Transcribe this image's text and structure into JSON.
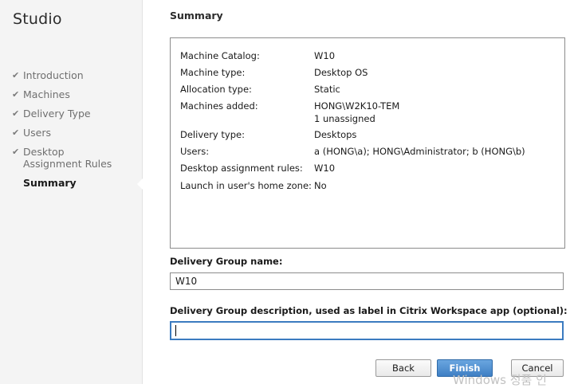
{
  "app": {
    "title": "Studio"
  },
  "sidebar": {
    "steps": [
      {
        "label": "Introduction",
        "completed": true
      },
      {
        "label": "Machines",
        "completed": true
      },
      {
        "label": "Delivery Type",
        "completed": true
      },
      {
        "label": "Users",
        "completed": true
      },
      {
        "label": "Desktop Assignment Rules",
        "completed": true
      },
      {
        "label": "Summary",
        "completed": false,
        "current": true
      }
    ],
    "check_glyph": "✔"
  },
  "main": {
    "title": "Summary",
    "summary": {
      "rows": [
        {
          "label": "Machine Catalog:",
          "value": "W10"
        },
        {
          "label": "Machine type:",
          "value": "Desktop OS"
        },
        {
          "label": "Allocation type:",
          "value": "Static"
        },
        {
          "label": "Machines added:",
          "value": "HONG\\W2K10-TEM",
          "value2": "1 unassigned"
        },
        {
          "label": "Delivery type:",
          "value": "Desktops"
        },
        {
          "label": "Users:",
          "value": "a (HONG\\a); HONG\\Administrator; b (HONG\\b)"
        },
        {
          "label": "Desktop assignment rules:",
          "value": "W10"
        },
        {
          "label": "Launch in user's home zone:",
          "value": "No"
        }
      ]
    },
    "delivery_group_name": {
      "label": "Delivery Group name:",
      "value": "W10"
    },
    "delivery_group_description": {
      "label": "Delivery Group description, used as label in Citrix Workspace app (optional):",
      "value": ""
    }
  },
  "buttons": {
    "back": "Back",
    "finish": "Finish",
    "cancel": "Cancel"
  },
  "watermark": "Windows 정품 인",
  "colors": {
    "accent": "#3f7fc4",
    "sidebar_bg": "#f4f4f4"
  }
}
